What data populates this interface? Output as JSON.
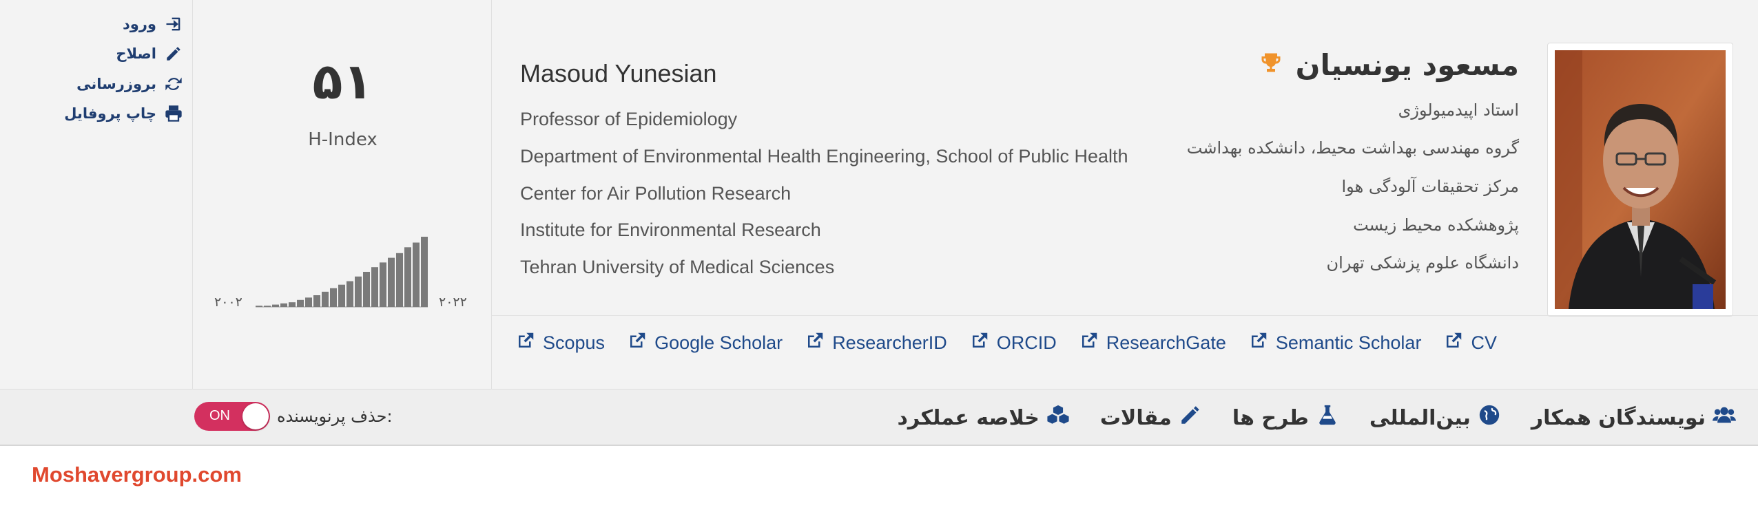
{
  "actions": [
    {
      "label": "ورود",
      "icon": "sign-in-icon"
    },
    {
      "label": "اصلاح",
      "icon": "pencil-icon"
    },
    {
      "label": "بروزرسانی",
      "icon": "refresh-icon"
    },
    {
      "label": "چاپ پروفایل",
      "icon": "print-icon"
    }
  ],
  "hindex": {
    "value": "۵۱",
    "label": "H-Index",
    "year_start": "۲۰۰۲",
    "year_end": "۲۰۲۲"
  },
  "chart_data": {
    "type": "bar",
    "categories": [
      "2002",
      "2003",
      "2004",
      "2005",
      "2006",
      "2007",
      "2008",
      "2009",
      "2010",
      "2011",
      "2012",
      "2013",
      "2014",
      "2015",
      "2016",
      "2017",
      "2018",
      "2019",
      "2020",
      "2021",
      "2022"
    ],
    "values": [
      1,
      1,
      2,
      3,
      4,
      6,
      8,
      10,
      13,
      16,
      19,
      22,
      26,
      30,
      34,
      38,
      42,
      46,
      51,
      55,
      60
    ]
  },
  "profile_en": {
    "name": "Masoud Yunesian",
    "lines": [
      "Professor of Epidemiology",
      "Department of Environmental Health Engineering, School of Public Health",
      "Center for Air Pollution Research",
      "Institute for Environmental Research",
      "Tehran University of Medical Sciences"
    ]
  },
  "profile_fa": {
    "name": "مسعود یونسیان",
    "award_icon": "trophy-icon",
    "lines": [
      "استاد اپیدمیولوژی",
      "گروه مهندسی بهداشت محیط، دانشکده بهداشت",
      "مرکز تحقیقات آلودگی هوا",
      "پژوهشکده محیط زیست",
      "دانشگاه علوم پزشکی تهران"
    ]
  },
  "links": [
    "Scopus",
    "Google Scholar",
    "ResearcherID",
    "ORCID",
    "ResearchGate",
    "Semantic Scholar",
    "CV"
  ],
  "tabs": [
    {
      "label": "خلاصه عملکرد",
      "icon": "cubes-icon"
    },
    {
      "label": "مقالات",
      "icon": "pencil-icon"
    },
    {
      "label": "طرح ها",
      "icon": "flask-icon"
    },
    {
      "label": "بین‌المللی",
      "icon": "globe-icon"
    },
    {
      "label": "نویسندگان همکار",
      "icon": "users-icon"
    }
  ],
  "toggle": {
    "state": "ON",
    "label": "حذف پرنویسنده:"
  },
  "watermark": "Moshavergroup.com",
  "colors": {
    "link": "#1f4a8a",
    "toggle": "#d3305f",
    "award": "#f0932b",
    "watermark": "#e0482e"
  }
}
